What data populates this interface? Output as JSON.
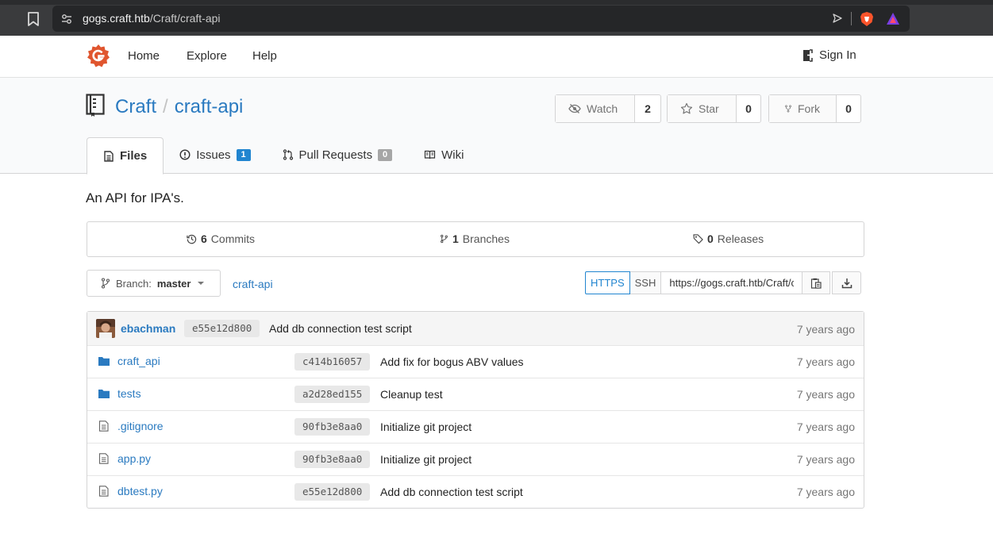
{
  "browser": {
    "url_host": "gogs.craft.htb",
    "url_path": "/Craft/craft-api"
  },
  "nav": {
    "items": [
      "Home",
      "Explore",
      "Help"
    ],
    "signin": "Sign In"
  },
  "repo": {
    "owner": "Craft",
    "separator": "/",
    "name": "craft-api",
    "watch_label": "Watch",
    "watch_count": "2",
    "star_label": "Star",
    "star_count": "0",
    "fork_label": "Fork",
    "fork_count": "0",
    "description": "An API for IPA's."
  },
  "tabs": [
    {
      "label": "Files",
      "active": true
    },
    {
      "label": "Issues",
      "badge": "1"
    },
    {
      "label": "Pull Requests",
      "badge": "0"
    },
    {
      "label": "Wiki"
    }
  ],
  "stats": {
    "commits_count": "6",
    "commits_label": "Commits",
    "branches_count": "1",
    "branches_label": "Branches",
    "releases_count": "0",
    "releases_label": "Releases"
  },
  "branch": {
    "prefix": "Branch:",
    "name": "master",
    "breadcrumb": "craft-api"
  },
  "clone": {
    "https": "HTTPS",
    "ssh": "SSH",
    "url": "https://gogs.craft.htb/Craft/craft-api.git"
  },
  "latest_commit": {
    "author": "ebachman",
    "sha": "e55e12d800",
    "message": "Add db connection test script",
    "age": "7 years ago"
  },
  "files": [
    {
      "name": "craft_api",
      "type": "folder",
      "sha": "c414b16057",
      "message": "Add fix for bogus ABV values",
      "age": "7 years ago"
    },
    {
      "name": "tests",
      "type": "folder",
      "sha": "a2d28ed155",
      "message": "Cleanup test",
      "age": "7 years ago"
    },
    {
      "name": ".gitignore",
      "type": "file",
      "sha": "90fb3e8aa0",
      "message": "Initialize git project",
      "age": "7 years ago"
    },
    {
      "name": "app.py",
      "type": "file",
      "sha": "90fb3e8aa0",
      "message": "Initialize git project",
      "age": "7 years ago"
    },
    {
      "name": "dbtest.py",
      "type": "file",
      "sha": "e55e12d800",
      "message": "Add db connection test script",
      "age": "7 years ago"
    }
  ],
  "colors": {
    "link": "#2a7ac0",
    "gogs_logo": "#e0552e",
    "badge_blue": "#2185d0",
    "folder_icon": "#2a7ac0"
  }
}
